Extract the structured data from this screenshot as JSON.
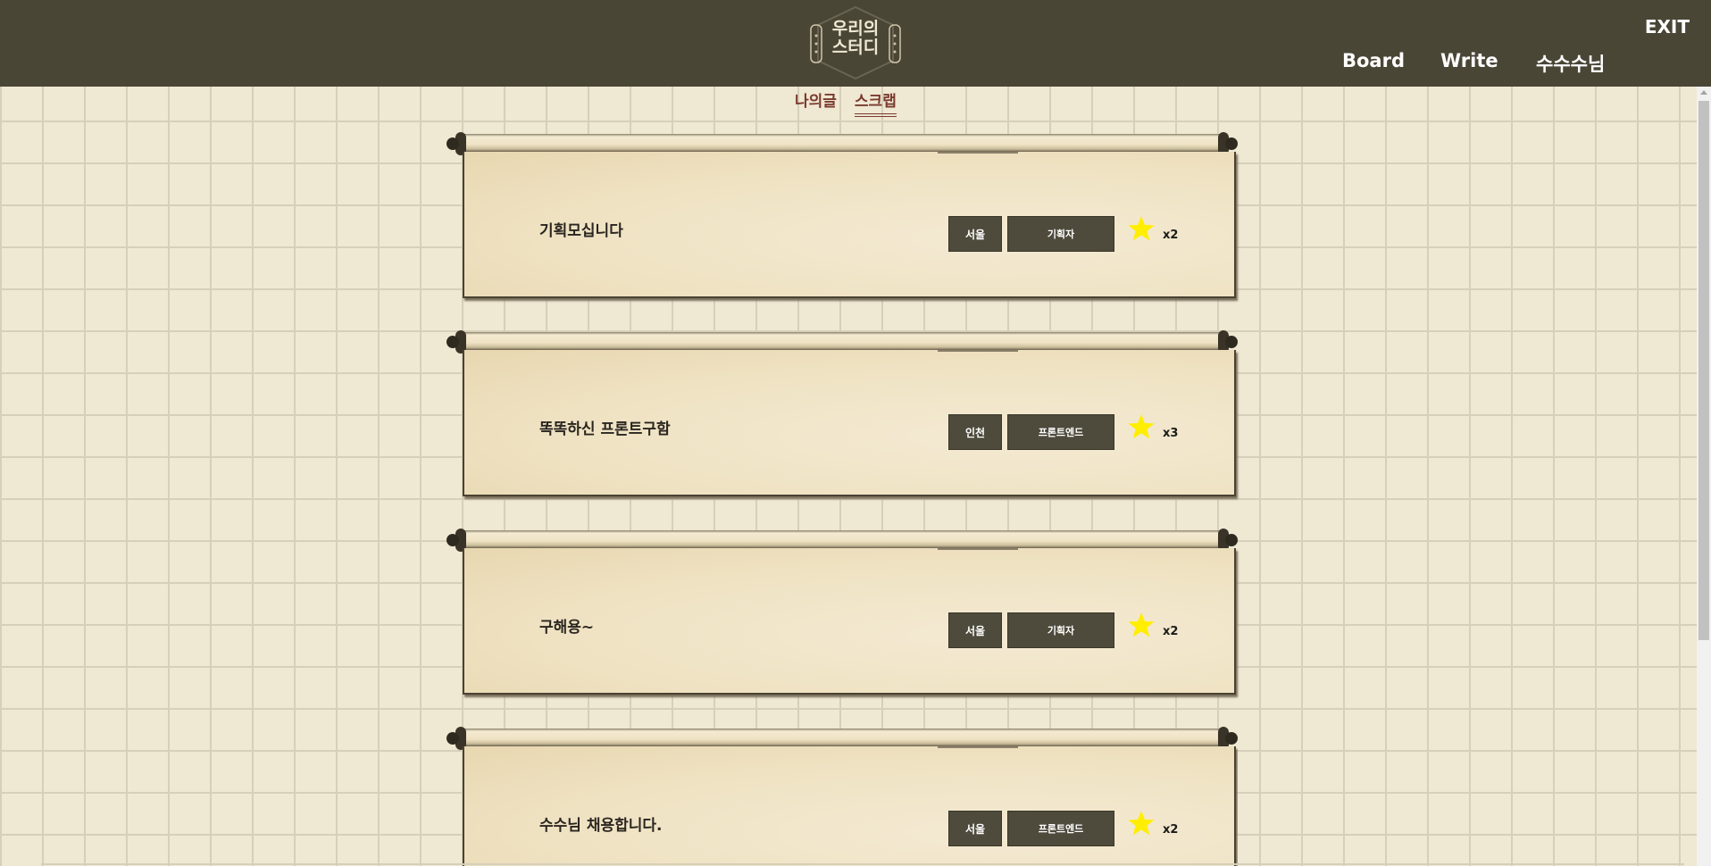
{
  "header": {
    "logo_line1": "우리의",
    "logo_line2": "스터디",
    "exit_label": "EXIT",
    "nav": {
      "board": "Board",
      "write": "Write",
      "user": "수수수님"
    }
  },
  "tabs": [
    {
      "label": "나의글",
      "active": false
    },
    {
      "label": "스크랩",
      "active": true
    }
  ],
  "posts": [
    {
      "title": "기획모십니다",
      "region": "서울",
      "role": "기획자",
      "star_count": "x2"
    },
    {
      "title": "똑똑하신 프론트구함",
      "region": "인천",
      "role": "프론트엔드",
      "star_count": "x3"
    },
    {
      "title": "구해용~",
      "region": "서울",
      "role": "기획자",
      "star_count": "x2"
    },
    {
      "title": "수수님 채용합니다.",
      "region": "서울",
      "role": "프론트엔드",
      "star_count": "x2"
    }
  ],
  "colors": {
    "header_bg": "#4a4636",
    "page_bg": "#efe8d3",
    "badge_bg": "#4e4a3c",
    "star": "#ffee00",
    "tab_active": "#7a3a2e"
  },
  "icons": {
    "star": "star-icon",
    "logo": "hexagon-logo-icon"
  }
}
